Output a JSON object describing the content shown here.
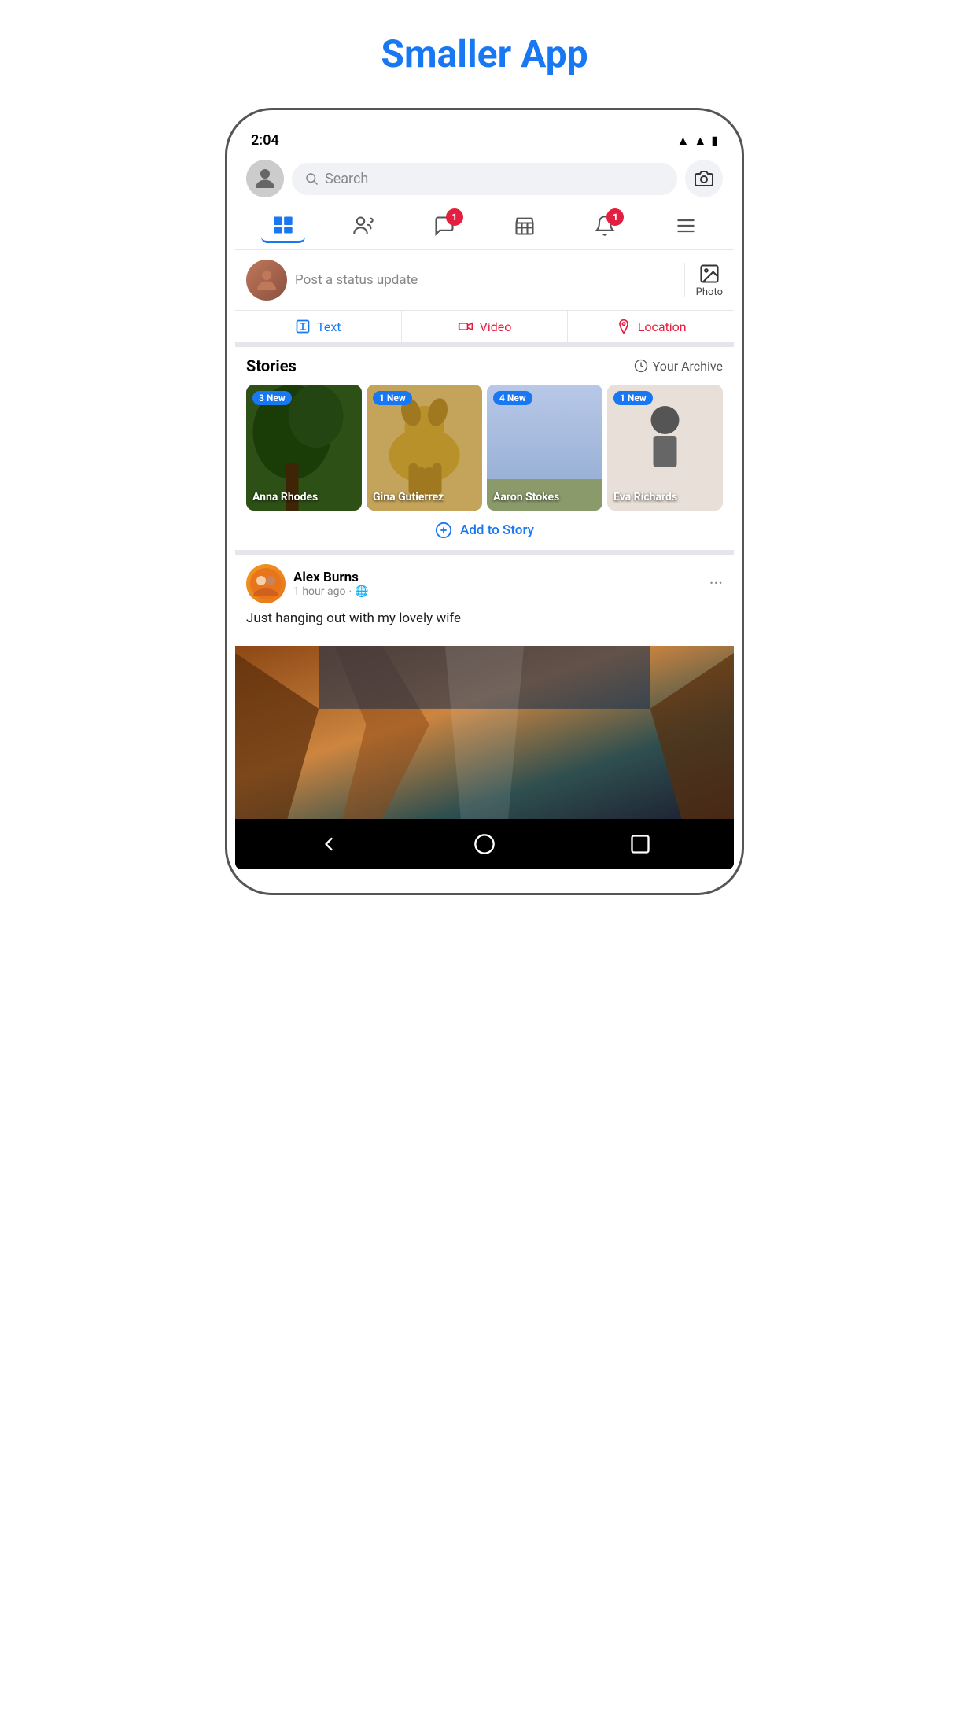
{
  "app": {
    "title": "Smaller App",
    "status_time": "2:04"
  },
  "header": {
    "search_placeholder": "Search"
  },
  "nav_icons": [
    {
      "name": "feed",
      "label": "Feed",
      "active": true
    },
    {
      "name": "friends",
      "label": "Friends",
      "active": false
    },
    {
      "name": "messages",
      "label": "Messages",
      "active": false,
      "badge": "1"
    },
    {
      "name": "marketplace",
      "label": "Marketplace",
      "active": false
    },
    {
      "name": "notifications",
      "label": "Notifications",
      "active": false,
      "badge": "1"
    },
    {
      "name": "menu",
      "label": "Menu",
      "active": false
    }
  ],
  "post_status": {
    "placeholder": "Post a status update",
    "photo_label": "Photo"
  },
  "post_actions": {
    "text_label": "Text",
    "video_label": "Video",
    "location_label": "Location"
  },
  "stories": {
    "title": "Stories",
    "archive_label": "Your Archive",
    "add_label": "Add to Story",
    "items": [
      {
        "name": "Anna Rhodes",
        "badge": "3 New",
        "bg": "anna"
      },
      {
        "name": "Gina Gutierrez",
        "badge": "1 New",
        "bg": "gina"
      },
      {
        "name": "Aaron Stokes",
        "badge": "4 New",
        "bg": "aaron"
      },
      {
        "name": "Eva Richards",
        "badge": "1 New",
        "bg": "eva"
      }
    ]
  },
  "post": {
    "author": "Alex Burns",
    "time": "1 hour ago",
    "privacy": "🌐",
    "text": "Just hanging out with my lovely wife"
  },
  "bottom_nav": {
    "back_label": "Back",
    "home_label": "Home",
    "recents_label": "Recents"
  }
}
